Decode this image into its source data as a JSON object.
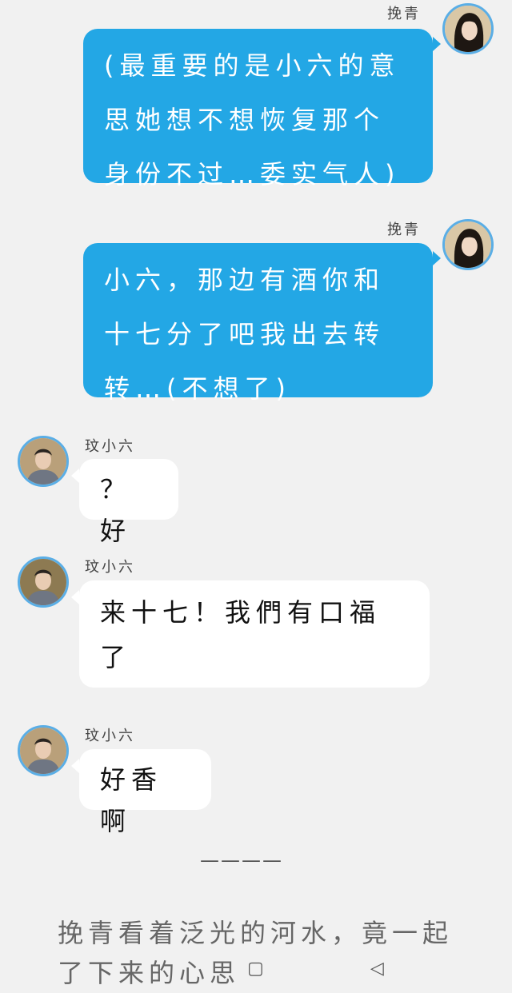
{
  "messages": [
    {
      "sender": "挽青",
      "direction": "out",
      "text": "(最重要的是小六的意思她想不想恢复那个身份不过…委实气人)"
    },
    {
      "sender": "挽青",
      "direction": "out",
      "text": "小六，那边有酒你和十七分了吧我出去转转…(不想了)"
    },
    {
      "sender": "玟小六",
      "direction": "in",
      "text": "？好"
    },
    {
      "sender": "玟小六",
      "direction": "in",
      "text": "来十七！我們有口福了"
    },
    {
      "sender": "玟小六",
      "direction": "in",
      "text": "好香啊"
    }
  ],
  "divider": "————",
  "narration": "挽青看着泛光的河水，竟一起了下来的心思",
  "nav": {
    "home_icon": "▢",
    "back_icon": "◁"
  },
  "colors": {
    "background": "#f1f1f1",
    "outgoing_bubble": "#23a7e5",
    "incoming_bubble": "#ffffff",
    "avatar_ring": "#5aaee6"
  }
}
